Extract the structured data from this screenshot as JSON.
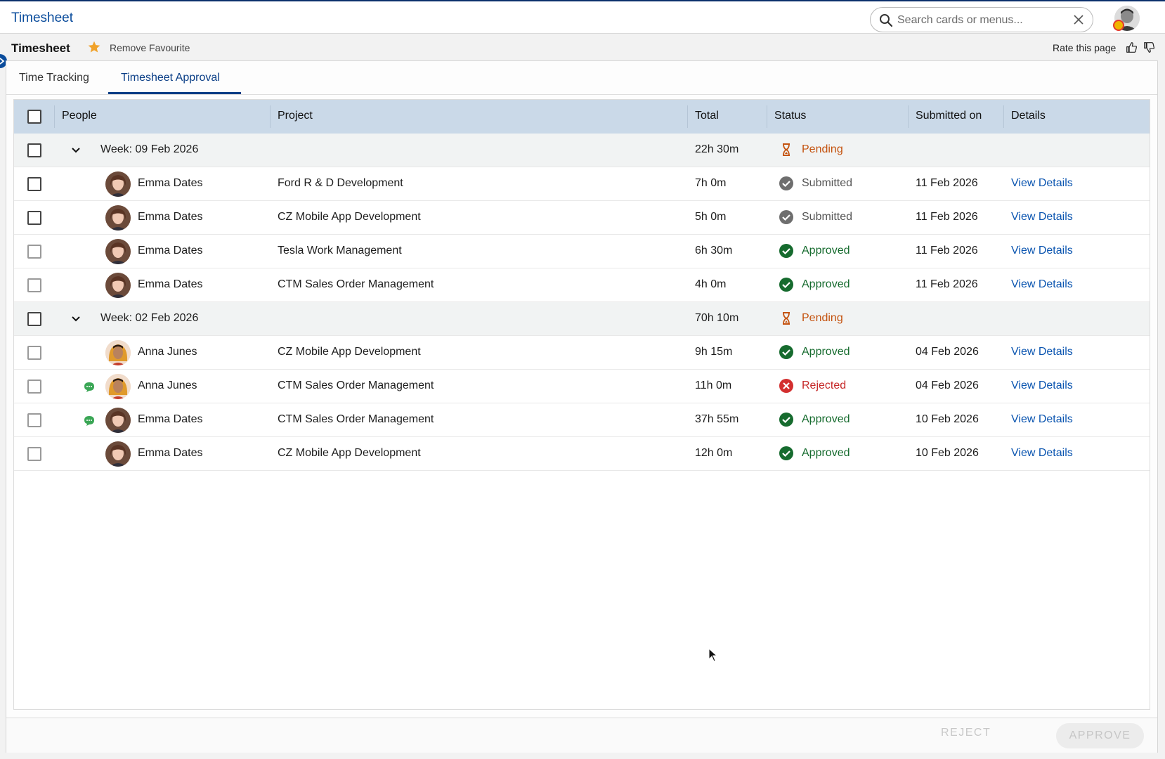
{
  "header": {
    "app_title": "Timesheet",
    "search_placeholder": "Search cards or menus..."
  },
  "subheader": {
    "page_title": "Timesheet",
    "favourite_label": "Remove Favourite",
    "rate_label": "Rate this page"
  },
  "tabs": [
    {
      "label": "Time Tracking",
      "active": false
    },
    {
      "label": "Timesheet Approval",
      "active": true
    }
  ],
  "table": {
    "columns": [
      "People",
      "Project",
      "Total",
      "Status",
      "Submitted on",
      "Details"
    ],
    "groups": [
      {
        "label": "Week: 09 Feb 2026",
        "total": "22h 30m",
        "status": "Pending",
        "rows": [
          {
            "person": "Emma Dates",
            "project": "Ford R & D Development",
            "total": "7h 0m",
            "status": "Submitted",
            "submitted_on": "11 Feb 2026",
            "details": "View Details",
            "comment": false
          },
          {
            "person": "Emma Dates",
            "project": "CZ Mobile App Development",
            "total": "5h 0m",
            "status": "Submitted",
            "submitted_on": "11 Feb 2026",
            "details": "View Details",
            "comment": false
          },
          {
            "person": "Emma Dates",
            "project": "Tesla Work Management",
            "total": "6h 30m",
            "status": "Approved",
            "submitted_on": "11 Feb 2026",
            "details": "View Details",
            "comment": false
          },
          {
            "person": "Emma Dates",
            "project": "CTM Sales Order Management",
            "total": "4h 0m",
            "status": "Approved",
            "submitted_on": "11 Feb 2026",
            "details": "View Details",
            "comment": false
          }
        ]
      },
      {
        "label": "Week: 02 Feb 2026",
        "total": "70h 10m",
        "status": "Pending",
        "rows": [
          {
            "person": "Anna Junes",
            "project": "CZ Mobile App Development",
            "total": "9h 15m",
            "status": "Approved",
            "submitted_on": "04 Feb 2026",
            "details": "View Details",
            "comment": false
          },
          {
            "person": "Anna Junes",
            "project": "CTM Sales Order Management",
            "total": "11h 0m",
            "status": "Rejected",
            "submitted_on": "04 Feb 2026",
            "details": "View Details",
            "comment": true
          },
          {
            "person": "Emma Dates",
            "project": "CTM Sales Order Management",
            "total": "37h 55m",
            "status": "Approved",
            "submitted_on": "10 Feb 2026",
            "details": "View Details",
            "comment": true
          },
          {
            "person": "Emma Dates",
            "project": "CZ Mobile App Development",
            "total": "12h 0m",
            "status": "Approved",
            "submitted_on": "10 Feb 2026",
            "details": "View Details",
            "comment": false
          }
        ]
      }
    ]
  },
  "footer": {
    "reject_label": "REJECT",
    "approve_label": "APPROVE"
  },
  "colors": {
    "brand": "#0a4c9c",
    "header_row": "#cad9e8",
    "approved": "#166b2e",
    "rejected": "#c62828",
    "pending": "#c4520e",
    "submitted": "#6e6e6e"
  }
}
